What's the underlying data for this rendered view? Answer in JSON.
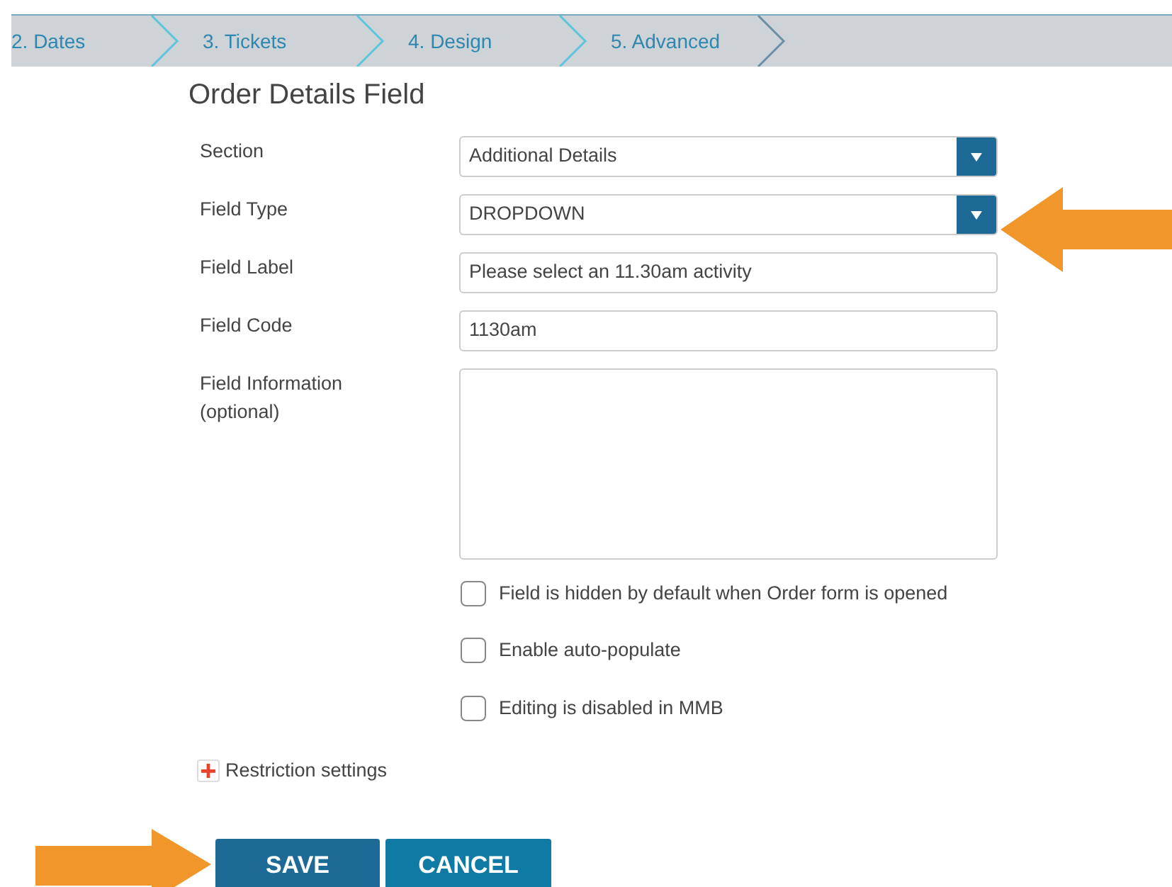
{
  "steps": [
    {
      "label": "2. Dates"
    },
    {
      "label": "3. Tickets"
    },
    {
      "label": "4. Design"
    },
    {
      "label": "5. Advanced"
    }
  ],
  "title": "Order Details Field",
  "fields": [
    {
      "kind": "select",
      "label": "Section",
      "value": "Additional Details"
    },
    {
      "kind": "select",
      "label": "Field Type",
      "value": "DROPDOWN"
    },
    {
      "kind": "text",
      "label": "Field Label",
      "value": "Please select an 11.30am activity"
    },
    {
      "kind": "text",
      "label": "Field Code",
      "value": "1130am"
    },
    {
      "kind": "textarea",
      "label": "Field Information (optional)"
    }
  ],
  "options": [
    {
      "label": "Field is hidden by default when Order form is opened",
      "checked": false
    },
    {
      "label": "Enable auto-populate",
      "checked": false
    },
    {
      "label": "Editing is disabled in MMB",
      "checked": false
    }
  ],
  "restriction": {
    "label": "Restriction settings",
    "expanded": false
  },
  "buttons": [
    {
      "label": "SAVE"
    },
    {
      "label": "CANCEL"
    }
  ]
}
